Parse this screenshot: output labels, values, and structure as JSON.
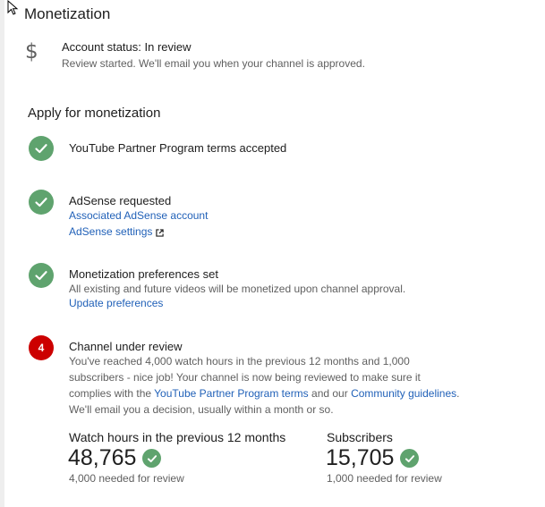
{
  "page": {
    "title": "Monetization"
  },
  "account_status": {
    "icon": "dollar-icon",
    "title": "Account status: In review",
    "subtitle": "Review started. We'll email you when your channel is approved."
  },
  "apply": {
    "title": "Apply for monetization",
    "steps": [
      {
        "status": "done",
        "title": "YouTube Partner Program terms accepted"
      },
      {
        "status": "done",
        "title": "AdSense requested",
        "link1": "Associated AdSense account",
        "link2": "AdSense settings"
      },
      {
        "status": "done",
        "title": "Monetization preferences set",
        "text": "All existing and future videos will be monetized upon channel approval.",
        "link": "Update preferences"
      },
      {
        "status": "pending",
        "number": "4",
        "title": "Channel under review",
        "line1": "You've reached 4,000 watch hours in the previous 12 months and 1,000",
        "line2": "subscribers - nice job! Your channel is now being reviewed to make sure it",
        "line3_a": "complies with the ",
        "line3_link1": "YouTube Partner Program terms",
        "line3_b": " and our ",
        "line3_link2": "Community guidelines",
        "line3_c": ".",
        "line4": "We'll email you a decision, usually within a month or so."
      }
    ]
  },
  "metrics": {
    "watch_hours": {
      "label": "Watch hours in the previous 12 months",
      "value": "48,765",
      "note": "4,000 needed for review"
    },
    "subscribers": {
      "label": "Subscribers",
      "value": "15,705",
      "note": "1,000 needed for review"
    }
  },
  "colors": {
    "success": "#5fa36e",
    "alert": "#cc0000",
    "link": "#2161b8"
  }
}
